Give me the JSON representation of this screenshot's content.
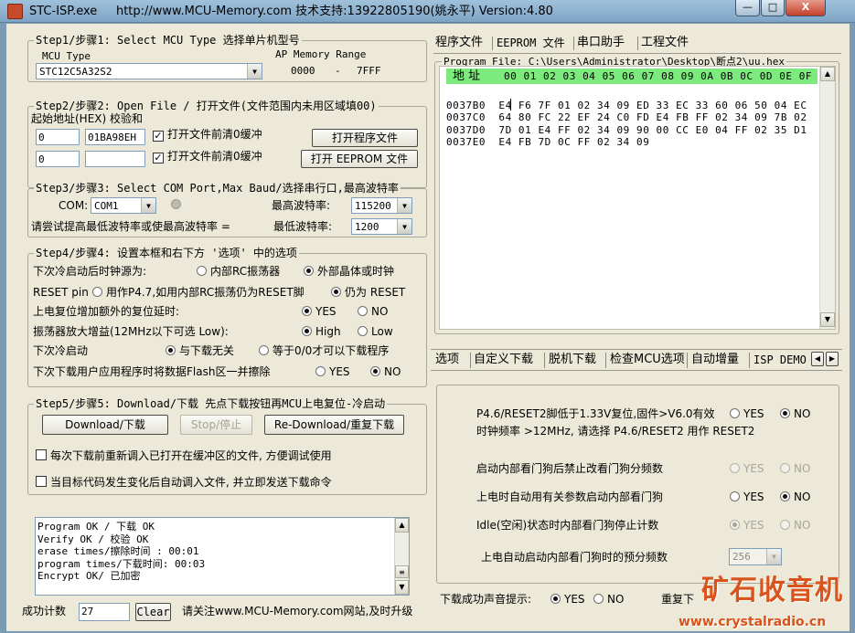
{
  "window": {
    "title": "STC-ISP.exe",
    "url_info": "http://www.MCU-Memory.com 技术支持:13922805190(姚永平) Version:4.80"
  },
  "step1": {
    "legend": "Step1/步骤1: Select MCU Type  选择单片机型号",
    "mcu_type_label": "MCU Type",
    "mcu_value": "STC12C5A32S2",
    "ap_label": "AP Memory Range",
    "ap_start": "0000",
    "ap_dash": "-",
    "ap_end": "7FFF"
  },
  "step2": {
    "legend": "Step2/步骤2: Open File / 打开文件(文件范围内未用区域填00)",
    "addr_label": "起始地址(HEX) 校验和",
    "addr1": "0",
    "checksum1": "01BA98EH",
    "clear1_label": "打开文件前清0缓冲",
    "open_program_button": "打开程序文件",
    "addr2": "0",
    "checksum2": "",
    "clear2_label": "打开文件前清0缓冲",
    "open_eeprom_button": "打开 EEPROM 文件"
  },
  "step3": {
    "legend": "Step3/步骤3: Select COM Port,Max Baud/选择串行口,最高波特率",
    "com_label": "COM:",
    "com_value": "COM1",
    "max_baud_label": "最高波特率:",
    "max_baud_value": "115200",
    "hint": "请尝试提高最低波特率或使最高波特率 =",
    "min_baud_label": "最低波特率:",
    "min_baud_value": "1200"
  },
  "step4": {
    "legend": "Step4/步骤4: 设置本框和右下方 '选项' 中的选项",
    "clock_label": "下次冷启动后时钟源为:",
    "clock_opt1": "内部RC振荡器",
    "clock_opt2": "外部晶体或时钟",
    "reset_label": "RESET pin",
    "reset_opt1": "用作P4.7,如用内部RC振荡仍为RESET脚",
    "reset_opt2": "仍为 RESET",
    "delay_label": "上电复位增加额外的复位延时:",
    "delay_yes": "YES",
    "delay_no": "NO",
    "gain_label": "振荡器放大增益(12MHz以下可选 Low):",
    "gain_high": "High",
    "gain_low": "Low",
    "cold_label": "下次冷启动",
    "cold_opt1": "与下载无关",
    "cold_opt2": "等于0/0才可以下载程序",
    "erase_label": "下次下载用户应用程序时将数据Flash区一并擦除",
    "erase_yes": "YES",
    "erase_no": "NO"
  },
  "step5": {
    "legend": "Step5/步骤5: Download/下载  先点下载按钮再MCU上电复位-冷启动",
    "download_button": "Download/下载",
    "stop_button": "Stop/停止",
    "redownload_button": "Re-Download/重复下载",
    "reload_label": "每次下载前重新调入已打开在缓冲区的文件, 方便调试使用",
    "auto_label": "当目标代码发生变化后自动调入文件, 并立即发送下载命令"
  },
  "log": {
    "lines": [
      "Program OK / 下载 OK",
      "Verify  OK / 校验 OK",
      "erase times/擦除时间 :  00:01",
      "program times/下载时间: 00:03",
      "Encrypt OK/ 已加密"
    ]
  },
  "bottom": {
    "success_label": "成功计数",
    "success_value": "27",
    "clear_button": "Clear",
    "notice": "请关注www.MCU-Memory.com网站,及时升级"
  },
  "top_tabs": [
    "程序文件",
    "EEPROM 文件",
    "串口助手",
    "工程文件"
  ],
  "hex": {
    "program_file": "Program File: C:\\Users\\Administrator\\Desktop\\断点2\\uu.hex",
    "addr_header": "地 址",
    "header_bytes": "00 01 02 03 04 05 06 07 08 09 0A 0B 0C 0D 0E 0F",
    "rows": [
      {
        "addr": "0037B0",
        "bytes": "E4 F6 7F 01 02 34 09 ED 33 EC 33 60 06 50 04 EC"
      },
      {
        "addr": "0037C0",
        "bytes": "64 80 FC 22 EF 24 C0 FD E4 FB FF 02 34 09 7B 02"
      },
      {
        "addr": "0037D0",
        "bytes": "7D 01 E4 FF 02 34 09 90 00 CC E0 04 FF 02 35 D1"
      },
      {
        "addr": "0037E0",
        "bytes": "E4 FB 7D 0C FF 02 34 09"
      }
    ]
  },
  "option_tabs": [
    "选项",
    "自定义下载",
    "脱机下载",
    "检查MCU选项",
    "自动增量",
    "ISP DEMO"
  ],
  "options": {
    "p46_line1": "P4.6/RESET2脚低于1.33V复位,固件>V6.0有效",
    "p46_yes": "YES",
    "p46_no": "NO",
    "p46_line2": "时钟频率 >12MHz, 请选择 P4.6/RESET2 用作 RESET2",
    "wdt1_label": "启动内部看门狗后禁止改看门狗分频数",
    "wdt1_yes": "YES",
    "wdt1_no": "NO",
    "wdt2_label": "上电时自动用有关参数启动内部看门狗",
    "wdt2_yes": "YES",
    "wdt2_no": "NO",
    "idle_label": "Idle(空闲)状态时内部看门狗停止计数",
    "idle_yes": "YES",
    "idle_no": "NO",
    "prescale_label": "上电自动启动内部看门狗时的预分频数",
    "prescale_value": "256"
  },
  "sound": {
    "label": "下载成功声音提示:",
    "yes": "YES",
    "no": "NO",
    "repeat_label": "重复下"
  },
  "watermark": {
    "text": "矿石收音机",
    "url": "www.crystalradio.cn"
  },
  "colors": {
    "hex_header_bg": "#7dea7d",
    "title_gradient": "#8fb3d2"
  }
}
